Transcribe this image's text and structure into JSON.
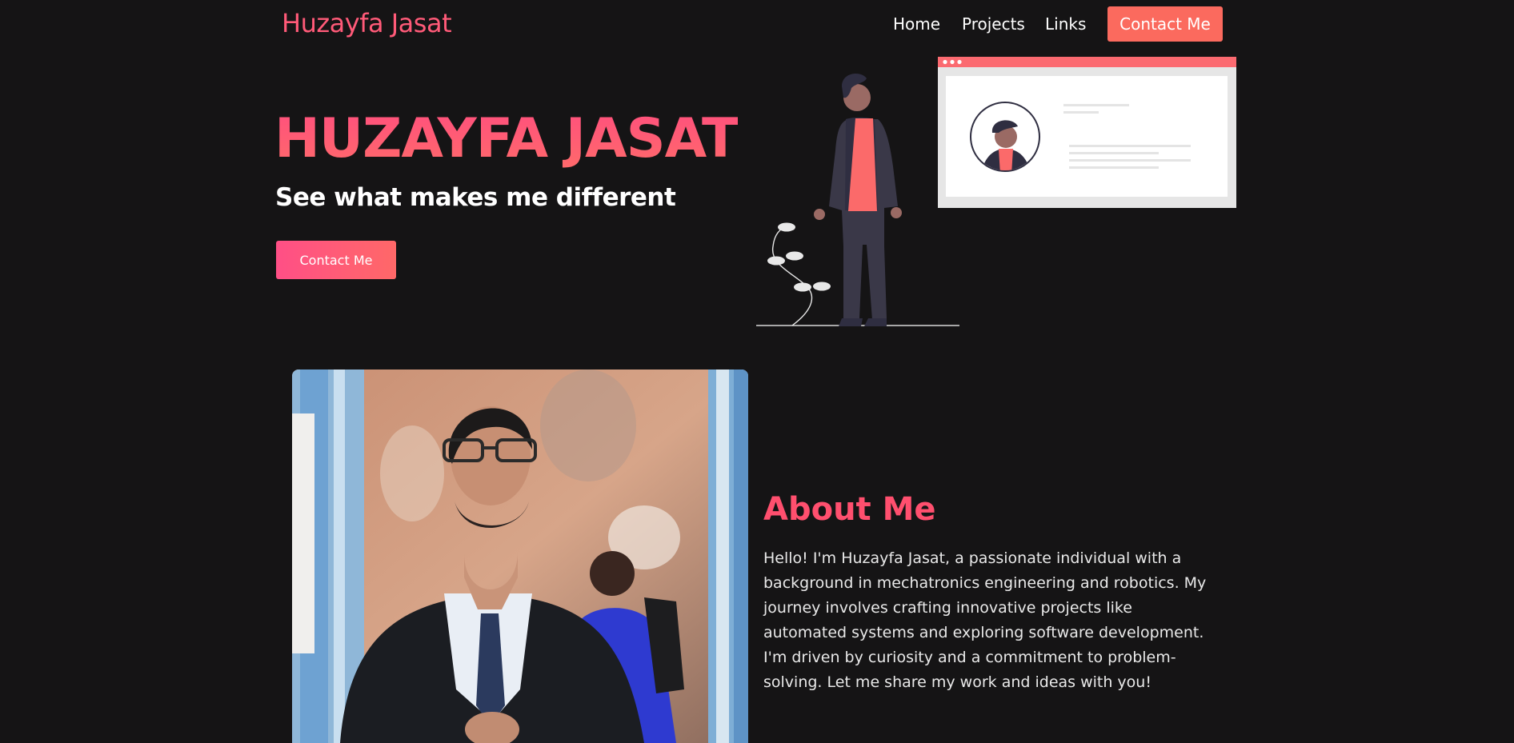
{
  "header": {
    "brand": "Huzayfa Jasat",
    "nav": [
      {
        "label": "Home"
      },
      {
        "label": "Projects"
      },
      {
        "label": "Links"
      }
    ],
    "contact_label": "Contact Me"
  },
  "hero": {
    "title": "HUZAYFA JASAT",
    "subtitle": "See what makes me different",
    "button_label": "Contact Me"
  },
  "about": {
    "title": "About Me",
    "text": "Hello! I'm Huzayfa Jasat, a passionate individual with a background in mechatronics engineering and robotics. My journey involves crafting innovative projects like automated systems and exploring software development. I'm driven by curiosity and a commitment to problem-solving. Let me share my work and ideas with you!"
  },
  "colors": {
    "background": "#151415",
    "accent": "#ff5a78",
    "contact_button": "#fb6a5e"
  },
  "icons": [
    "profile-illustration",
    "portrait-photo"
  ]
}
